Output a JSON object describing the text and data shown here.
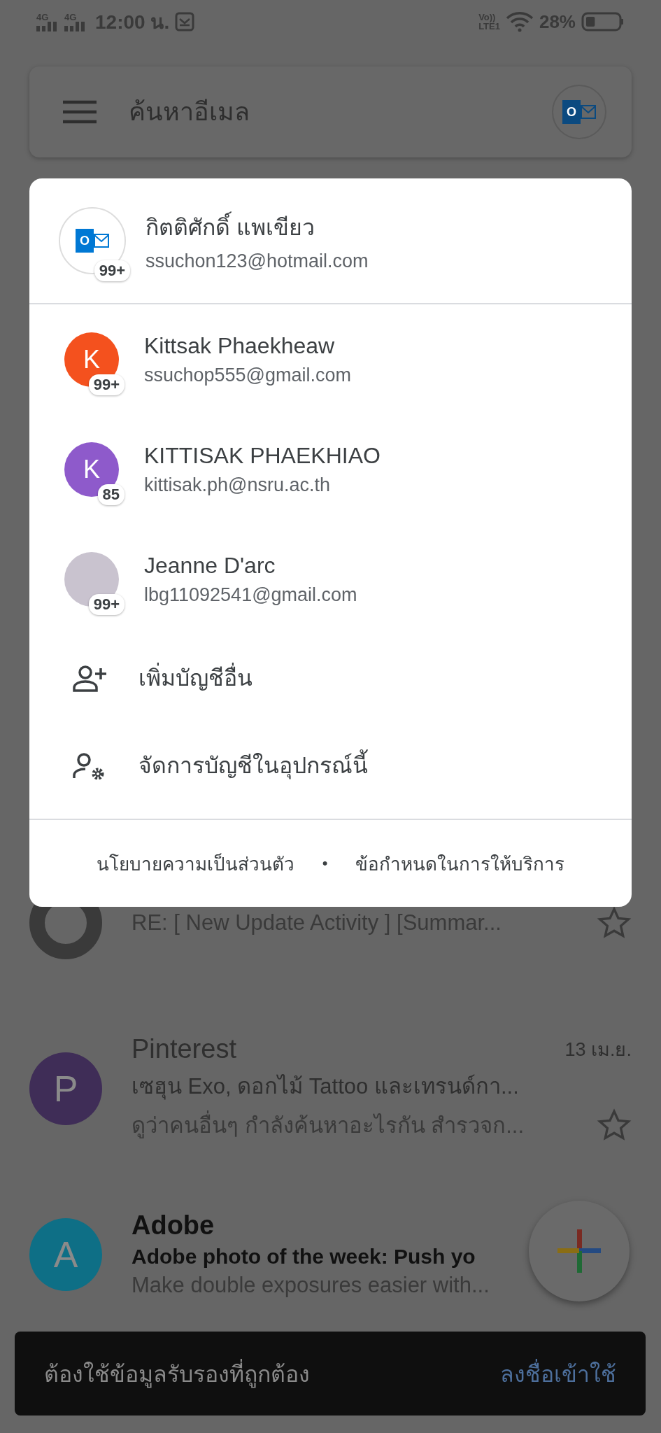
{
  "status_bar": {
    "networks": [
      "4G",
      "4G"
    ],
    "time": "12:00 น.",
    "volte": "Vo))",
    "lte": "LTE1",
    "battery": "28%"
  },
  "search_bar": {
    "placeholder": "ค้นหาอีเมล",
    "logo_letter": "O"
  },
  "emails": [
    {
      "kind": "ring",
      "snippet": "RE: [ New Update Activity  ] [Summar...",
      "starred": false
    },
    {
      "kind": "letter",
      "letter": "P",
      "color": "#3f2d57",
      "sender": "Pinterest",
      "date": "13 เม.ย.",
      "subject": "เซฮุน Exo, ดอกไม้ Tattoo และเทรนด์กา...",
      "snippet": "ดูว่าคนอื่นๆ กำลังค้นหาอะไรกัน สำรวจก...",
      "unread": false,
      "starred": false
    },
    {
      "kind": "letter",
      "letter": "A",
      "color": "#0e6f86",
      "sender": "Adobe",
      "subject": "Adobe photo of the week: Push yo",
      "snippet": "Make double exposures easier with...",
      "unread": true
    }
  ],
  "account_menu": {
    "current": {
      "name": "กิตติศักดิ์ แพเขียว",
      "email": "ssuchon123@hotmail.com",
      "badge": "99+",
      "logo_letter": "O"
    },
    "accounts": [
      {
        "kind": "letter",
        "letter": "K",
        "color": "#f4511e",
        "name": "Kittsak Phaekheaw",
        "email": "ssuchop555@gmail.com",
        "badge": "99+"
      },
      {
        "kind": "letter",
        "letter": "K",
        "color": "#8e5acb",
        "name": "KITTISAK PHAEKHIAO",
        "email": "kittisak.ph@nsru.ac.th",
        "badge": "85"
      },
      {
        "kind": "photo",
        "name": "Jeanne D'arc",
        "email": "lbg11092541@gmail.com",
        "badge": "99+"
      }
    ],
    "actions": [
      {
        "kind": "add",
        "label": "เพิ่มบัญชีอื่น"
      },
      {
        "kind": "manage",
        "label": "จัดการบัญชีในอุปกรณ์นี้"
      }
    ],
    "footer": {
      "links": [
        "นโยบายความเป็นส่วนตัว",
        "ข้อกำหนดในการให้บริการ"
      ],
      "separator": "•"
    }
  },
  "snackbar": {
    "message": "ต้องใช้ข้อมูลรับรองที่ถูกต้อง",
    "action": "ลงชื่อเข้าใช้"
  }
}
